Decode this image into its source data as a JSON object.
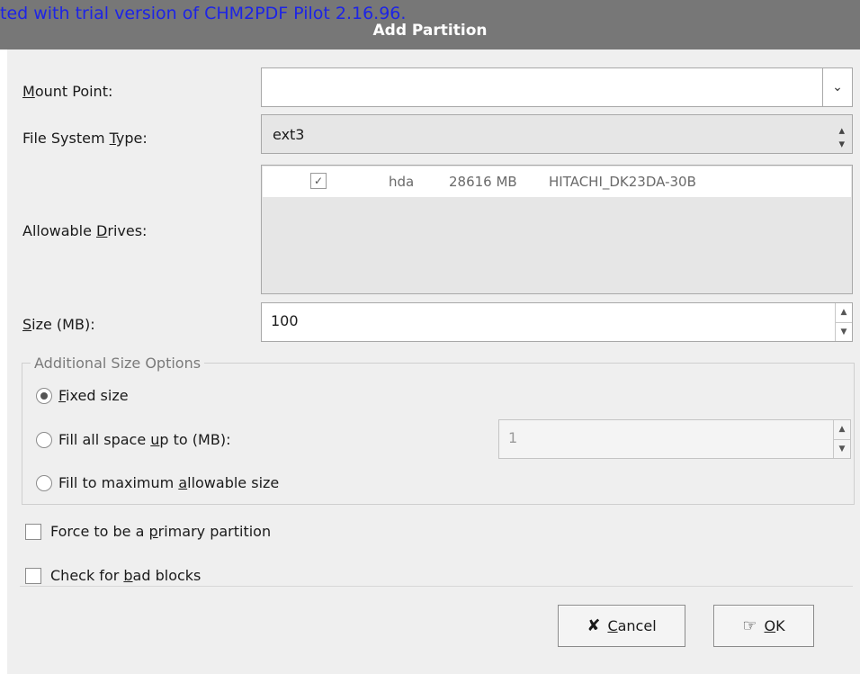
{
  "watermark": "ted with trial version of CHM2PDF Pilot 2.16.96.",
  "window": {
    "title": "Add Partition"
  },
  "form": {
    "mount_point": {
      "label": "Mount Point:",
      "value": ""
    },
    "fs_type": {
      "label": "File System Type:",
      "value": "ext3"
    },
    "drives": {
      "label": "Allowable Drives:",
      "items": [
        {
          "checked": true,
          "name": "hda",
          "size": "28616 MB",
          "model": "HITACHI_DK23DA-30B"
        }
      ]
    },
    "size": {
      "label": "Size (MB):",
      "value": "100"
    }
  },
  "size_options": {
    "title": "Additional Size Options",
    "fixed": "Fixed size",
    "fill_upto": "Fill all space up to (MB):",
    "fill_upto_value": "1",
    "fill_max": "Fill to maximum allowable size",
    "selected": "fixed"
  },
  "options": {
    "primary": "Force to be a primary partition",
    "badblocks": "Check for bad blocks"
  },
  "buttons": {
    "cancel": "Cancel",
    "ok": "OK"
  },
  "icons": {
    "dropdown": "chevron-down-icon",
    "cancel": "cancel-icon",
    "ok": "ok-hand-icon"
  }
}
